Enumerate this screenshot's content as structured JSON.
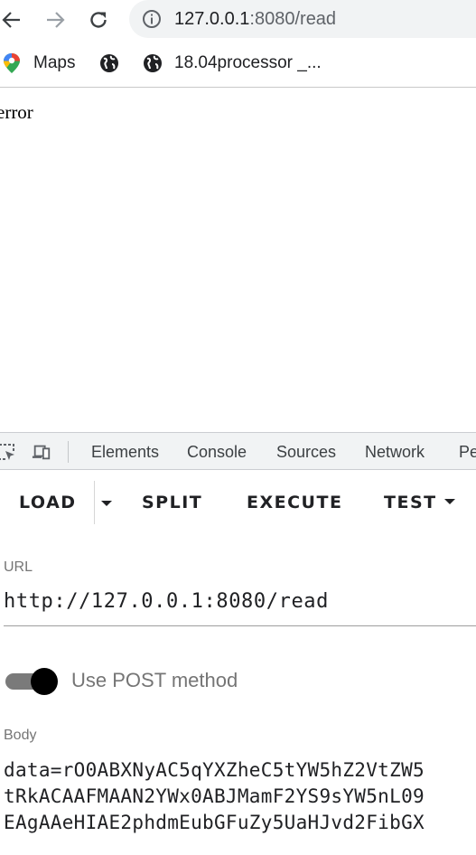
{
  "browser": {
    "omnibox": {
      "host": "127.0.0.1",
      "path": ":8080/read"
    },
    "bookmarks": [
      {
        "label": "Maps",
        "icon": "maps-pin-icon"
      },
      {
        "label": "",
        "icon": "globe-icon"
      },
      {
        "label": "18.04processor _...",
        "icon": "globe-icon"
      }
    ]
  },
  "page": {
    "text": "error"
  },
  "devtools": {
    "tabs": [
      "Elements",
      "Console",
      "Sources",
      "Network",
      "Pe"
    ]
  },
  "panel": {
    "buttons": {
      "load": "LOAD",
      "split": "SPLIT",
      "execute": "EXECUTE",
      "test": "TEST"
    },
    "url_label": "URL",
    "url_value": "http://127.0.0.1:8080/read",
    "post_toggle": {
      "label": "Use POST method",
      "checked": true
    },
    "body_label": "Body",
    "body_lines": [
      "data=rO0ABXNyAC5qYXZheC5tYW5hZ2VtZW5",
      "tRkACAAFMAAN2YWx0ABJMamF2YS9sYW5nL09",
      "EAgAAeHIAE2phdmEubGFuZy5UaHJvd2FibGX"
    ]
  },
  "colors": {
    "toggle_thumb": "#000000",
    "toggle_track": "#7a7a7a",
    "omnibox_bg": "#f1f3f4"
  }
}
